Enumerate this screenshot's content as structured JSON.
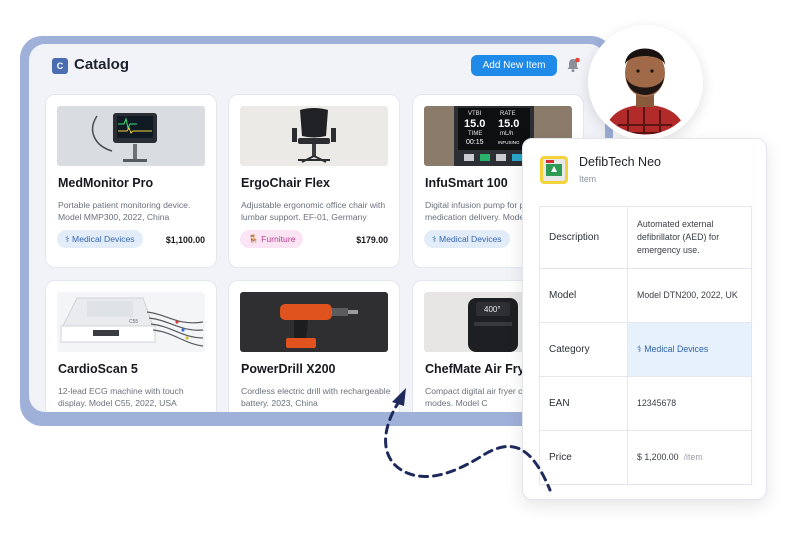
{
  "catalog": {
    "logo_letter": "C",
    "title": "Catalog",
    "add_button": "Add New Item",
    "items": [
      {
        "name": "MedMonitor Pro",
        "description": "Portable patient monitoring device. Model MMP300, 2022, China",
        "category": "⚕ Medical Devices",
        "price": "$1,100.00"
      },
      {
        "name": "ErgoChair Flex",
        "description": "Adjustable ergonomic office chair with lumbar support. EF-01, Germany",
        "category": "🪑 Furniture",
        "price": "$179.00"
      },
      {
        "name": "InfuSmart 100",
        "description": "Digital infusion pump for precise medication delivery. Model",
        "category": "⚕ Medical Devices",
        "price": ""
      },
      {
        "name": "CardioScan 5",
        "description": "12-lead ECG machine with touch display. Model C55, 2022, USA",
        "category": "",
        "price": ""
      },
      {
        "name": "PowerDrill X200",
        "description": "Cordless electric drill with rechargeable battery. 2023, China",
        "category": "",
        "price": ""
      },
      {
        "name": "ChefMate Air Fry",
        "description": "Compact digital air fryer cooking modes. Model C",
        "category": "",
        "price": ""
      }
    ],
    "screen_text": {
      "pump_l1": "VTBI",
      "pump_l2": "RATE",
      "pump_v1": "15.0",
      "pump_v2": "15.0",
      "pump_l3": "TIME",
      "pump_l4": "mL/h",
      "pump_v3": "00:15",
      "pump_v4": "INFUSING",
      "fryer": "400°",
      "ecg_brand": "C55"
    }
  },
  "detail": {
    "name": "DefibTech Neo",
    "subtitle": "Item",
    "rows": [
      {
        "key": "Description",
        "value": "Automated external defibrillator (AED) for emergency use."
      },
      {
        "key": "Model",
        "value": "Model DTN200, 2022, UK"
      },
      {
        "key": "Category",
        "value": "⚕ Medical Devices"
      },
      {
        "key": "EAN",
        "value": "12345678"
      },
      {
        "key": "Price",
        "value": "$  1,200.00",
        "unit": "/item"
      }
    ]
  },
  "colors": {
    "accent": "#1f8ae8",
    "frame": "#9fb0d9",
    "panel": "#f1f3f8",
    "arrow": "#1f2a5c"
  }
}
